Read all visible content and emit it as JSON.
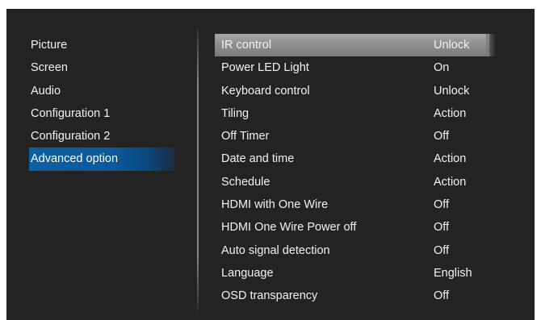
{
  "left_menu": {
    "items": [
      {
        "label": "Picture"
      },
      {
        "label": "Screen"
      },
      {
        "label": "Audio"
      },
      {
        "label": "Configuration 1"
      },
      {
        "label": "Configuration 2"
      },
      {
        "label": "Advanced option"
      }
    ],
    "active_index": 5
  },
  "settings": {
    "highlighted_index": 0,
    "rows": [
      {
        "label": "IR control",
        "value": "Unlock"
      },
      {
        "label": "Power LED Light",
        "value": "On"
      },
      {
        "label": "Keyboard control",
        "value": "Unlock"
      },
      {
        "label": "Tiling",
        "value": "Action"
      },
      {
        "label": "Off Timer",
        "value": "Off"
      },
      {
        "label": "Date and time",
        "value": "Action"
      },
      {
        "label": "Schedule",
        "value": "Action"
      },
      {
        "label": "HDMI with One Wire",
        "value": "Off"
      },
      {
        "label": "HDMI One Wire Power off",
        "value": "Off"
      },
      {
        "label": "Auto signal detection",
        "value": "Off"
      },
      {
        "label": "Language",
        "value": "English"
      },
      {
        "label": "OSD transparency",
        "value": "Off"
      }
    ]
  },
  "colors": {
    "panel_background": "#232323",
    "text": "#f2f2f2",
    "active_menu": "#0b5b9c",
    "highlight_row": "#8c8c8c"
  }
}
